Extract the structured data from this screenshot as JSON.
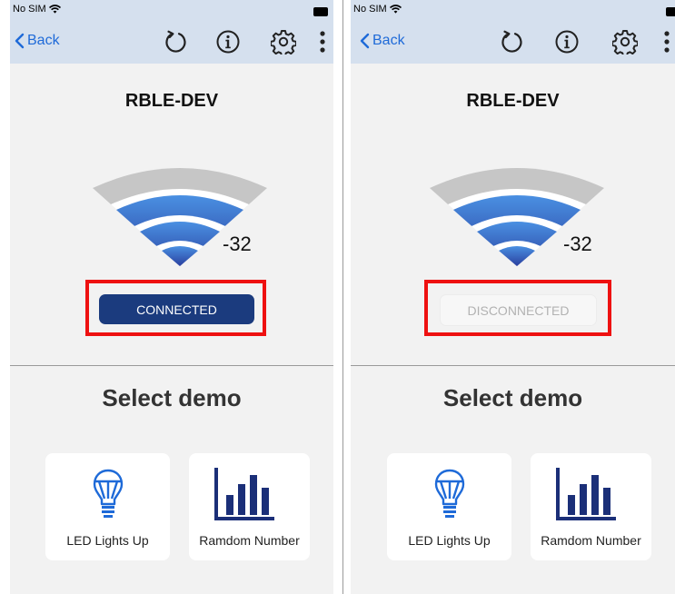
{
  "status_bar": {
    "carrier": "No SIM"
  },
  "nav": {
    "back_label": "Back"
  },
  "screens": [
    {
      "device_name": "RBLE-DEV",
      "rssi": "-32",
      "connection_button": "CONNECTED",
      "connected": true,
      "select_title": "Select demo",
      "demos": [
        {
          "label": "LED Lights Up",
          "icon": "lightbulb-icon"
        },
        {
          "label": "Ramdom Number",
          "icon": "bar-chart-icon"
        }
      ]
    },
    {
      "device_name": "RBLE-DEV",
      "rssi": "-32",
      "connection_button": "DISCONNECTED",
      "connected": false,
      "select_title": "Select demo",
      "demos": [
        {
          "label": "LED Lights Up",
          "icon": "lightbulb-icon"
        },
        {
          "label": "Ramdom Number",
          "icon": "bar-chart-icon"
        }
      ]
    }
  ],
  "colors": {
    "nav_bg": "#d5e0ee",
    "accent_blue": "#1e6ad8",
    "connected_button": "#1b3b7e",
    "highlight_red": "#ee1111",
    "wifi_inactive": "#c6c6c6",
    "wifi_active_light": "#4a90e2",
    "wifi_active_dark": "#2a3f9e"
  }
}
